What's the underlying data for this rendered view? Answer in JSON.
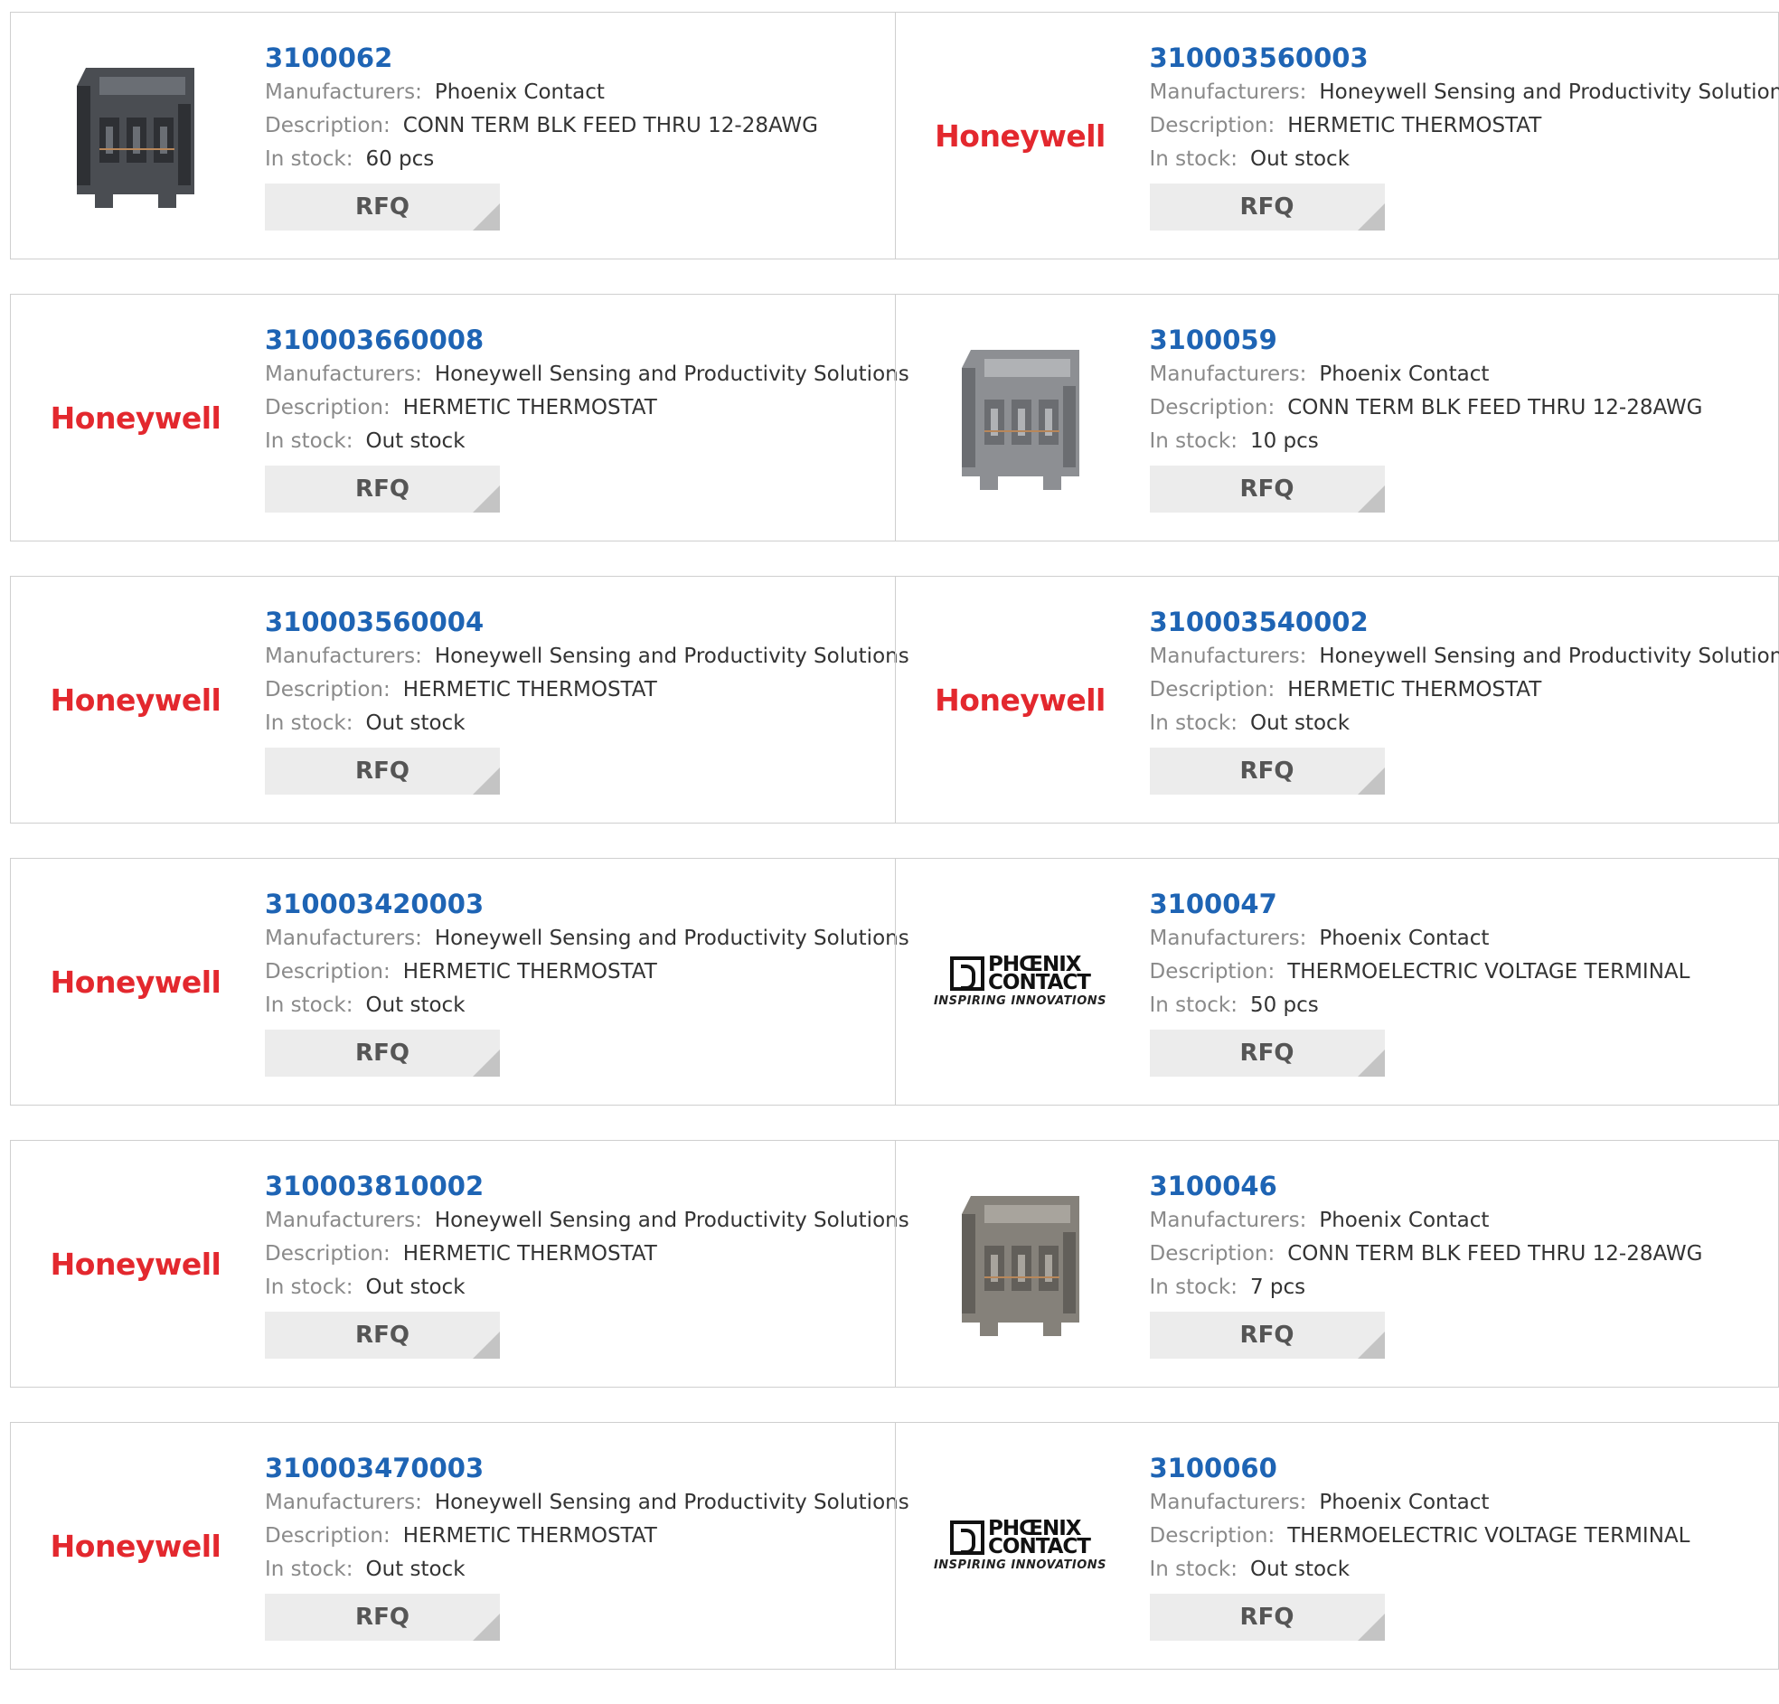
{
  "labels": {
    "manufacturers": "Manufacturers:",
    "description": "Description:",
    "stock": "In stock:",
    "rfq": "RFQ"
  },
  "logos": {
    "honeywell": "Honeywell",
    "phoenix_line1": "PHŒNIX",
    "phoenix_line2": "CONTACT",
    "phoenix_tag": "INSPIRING INNOVATIONS"
  },
  "products": [
    {
      "part": "3100062",
      "manufacturer": "Phoenix Contact",
      "description": "CONN TERM BLK FEED THRU 12-28AWG",
      "stock": "60 pcs",
      "thumb": "terminal-block",
      "tone": "dark"
    },
    {
      "part": "310003560003",
      "manufacturer": "Honeywell Sensing and Productivity Solutions",
      "description": "HERMETIC THERMOSTAT",
      "stock": "Out stock",
      "thumb": "honeywell"
    },
    {
      "part": "310003660008",
      "manufacturer": "Honeywell Sensing and Productivity Solutions",
      "description": "HERMETIC THERMOSTAT",
      "stock": "Out stock",
      "thumb": "honeywell"
    },
    {
      "part": "3100059",
      "manufacturer": "Phoenix Contact",
      "description": "CONN TERM BLK FEED THRU 12-28AWG",
      "stock": "10 pcs",
      "thumb": "terminal-block",
      "tone": "light"
    },
    {
      "part": "310003560004",
      "manufacturer": "Honeywell Sensing and Productivity Solutions",
      "description": "HERMETIC THERMOSTAT",
      "stock": "Out stock",
      "thumb": "honeywell"
    },
    {
      "part": "310003540002",
      "manufacturer": "Honeywell Sensing and Productivity Solutions",
      "description": "HERMETIC THERMOSTAT",
      "stock": "Out stock",
      "thumb": "honeywell"
    },
    {
      "part": "310003420003",
      "manufacturer": "Honeywell Sensing and Productivity Solutions",
      "description": "HERMETIC THERMOSTAT",
      "stock": "Out stock",
      "thumb": "honeywell"
    },
    {
      "part": "3100047",
      "manufacturer": "Phoenix Contact",
      "description": "THERMOELECTRIC VOLTAGE TERMINAL",
      "stock": "50 pcs",
      "thumb": "phoenix"
    },
    {
      "part": "310003810002",
      "manufacturer": "Honeywell Sensing and Productivity Solutions",
      "description": "HERMETIC THERMOSTAT",
      "stock": "Out stock",
      "thumb": "honeywell"
    },
    {
      "part": "3100046",
      "manufacturer": "Phoenix Contact",
      "description": "CONN TERM BLK FEED THRU 12-28AWG",
      "stock": "7 pcs",
      "thumb": "terminal-block",
      "tone": "warm"
    },
    {
      "part": "310003470003",
      "manufacturer": "Honeywell Sensing and Productivity Solutions",
      "description": "HERMETIC THERMOSTAT",
      "stock": "Out stock",
      "thumb": "honeywell"
    },
    {
      "part": "3100060",
      "manufacturer": "Phoenix Contact",
      "description": "THERMOELECTRIC VOLTAGE TERMINAL",
      "stock": "Out stock",
      "thumb": "phoenix"
    }
  ],
  "colors": {
    "link": "#1e64b4",
    "honeywell_red": "#e3282e",
    "rfq_bg": "#ececec",
    "border": "#cfcfcf"
  }
}
